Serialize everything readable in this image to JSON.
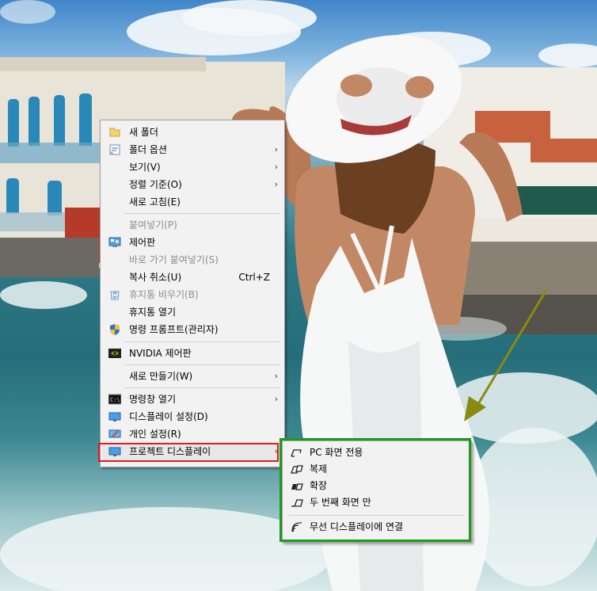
{
  "context_menu": {
    "items": [
      {
        "label": "새 폴더",
        "icon": "folder-icon",
        "enabled": true
      },
      {
        "label": "폴더 옵션",
        "icon": "folder-options-icon",
        "enabled": true,
        "submenu": true
      },
      {
        "label": "보기(V)",
        "enabled": true,
        "submenu": true
      },
      {
        "label": "정렬 기준(O)",
        "enabled": true,
        "submenu": true
      },
      {
        "label": "새로 고침(E)",
        "enabled": true
      },
      {
        "label": "붙여넣기(P)",
        "enabled": false
      },
      {
        "label": "제어판",
        "icon": "control-panel-icon",
        "enabled": true
      },
      {
        "label": "바로 가기 붙여넣기(S)",
        "enabled": false
      },
      {
        "label": "복사 취소(U)",
        "shortcut": "Ctrl+Z",
        "enabled": true
      },
      {
        "label": "휴지통 비우기(B)",
        "icon": "recycle-bin-icon",
        "enabled": false
      },
      {
        "label": "휴지통 열기",
        "enabled": true
      },
      {
        "label": "명령 프롬프트(관리자)",
        "icon": "uac-shield-icon",
        "enabled": true
      },
      {
        "label": "NVIDIA 제어판",
        "icon": "nvidia-icon",
        "enabled": true
      },
      {
        "label": "새로 만들기(W)",
        "enabled": true,
        "submenu": true
      },
      {
        "label": "명령창 열기",
        "icon": "cmd-icon",
        "enabled": true,
        "submenu": true
      },
      {
        "label": "디스플레이 설정(D)",
        "icon": "display-settings-icon",
        "enabled": true
      },
      {
        "label": "개인 설정(R)",
        "icon": "personalize-icon",
        "enabled": true
      },
      {
        "label": "프로젝트 디스플레이",
        "icon": "project-display-icon",
        "enabled": true,
        "submenu": true,
        "highlighted": true
      }
    ],
    "submenu_arrow": "›"
  },
  "project_submenu": {
    "items": [
      {
        "label": "PC 화면 전용",
        "icon": "pc-screen-only-icon"
      },
      {
        "label": "복제",
        "icon": "duplicate-icon"
      },
      {
        "label": "확장",
        "icon": "extend-icon"
      },
      {
        "label": "두 번째 화면 만",
        "icon": "second-screen-only-icon"
      },
      {
        "label": "무선 디스플레이에 연결",
        "icon": "wireless-display-icon"
      }
    ]
  },
  "colors": {
    "annotation_red": "#e21b1b",
    "annotation_green": "#1f9a1f",
    "arrow_olive": "#8a8a12",
    "menu_bg": "#f2f2f2"
  }
}
